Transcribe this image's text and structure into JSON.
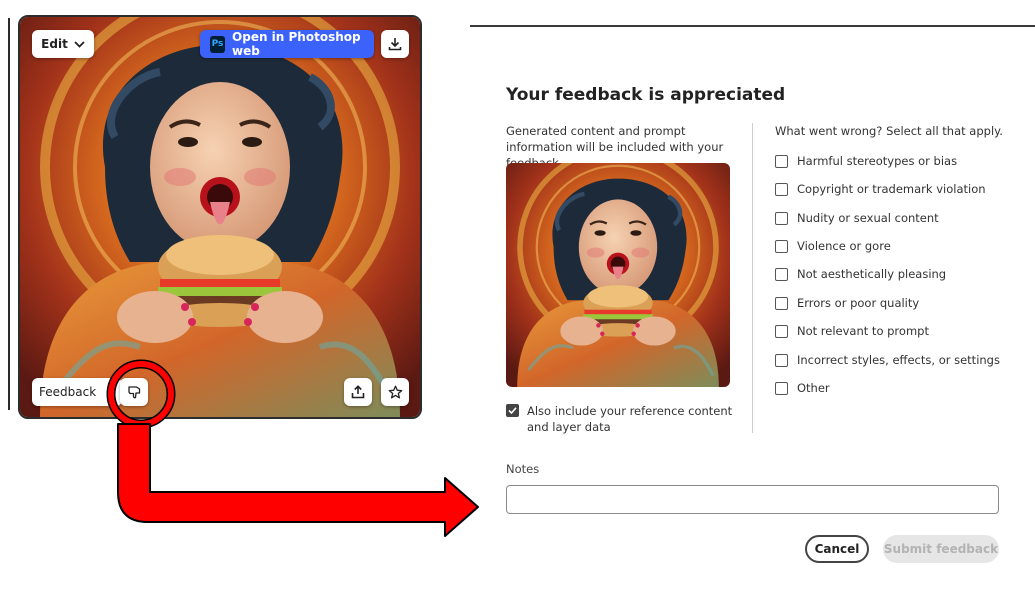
{
  "card": {
    "edit_label": "Edit",
    "ps_badge": "Ps",
    "open_ps_label": "Open in Photoshop web",
    "feedback_label": "Feedback",
    "icons": [
      "chevron-down-icon",
      "download-icon",
      "thumbs-down-icon",
      "share-icon",
      "star-icon"
    ]
  },
  "dialog": {
    "title": "Your feedback is appreciated",
    "info": "Generated content and prompt information will be included with your feedback.",
    "include_label": "Also include your reference content and layer data",
    "include_checked": true,
    "question": "What went wrong? Select all that apply.",
    "reasons": [
      "Harmful stereotypes or bias",
      "Copyright or trademark violation",
      "Nudity or sexual content",
      "Violence or gore",
      "Not aesthetically pleasing",
      "Errors or poor quality",
      "Not relevant to prompt",
      "Incorrect styles, effects, or settings",
      "Other"
    ],
    "notes_label": "Notes",
    "notes_value": "",
    "cancel_label": "Cancel",
    "submit_label": "Submit feedback"
  },
  "colors": {
    "accent_blue": "#3b63fb",
    "annotation_red": "#ff0000"
  }
}
